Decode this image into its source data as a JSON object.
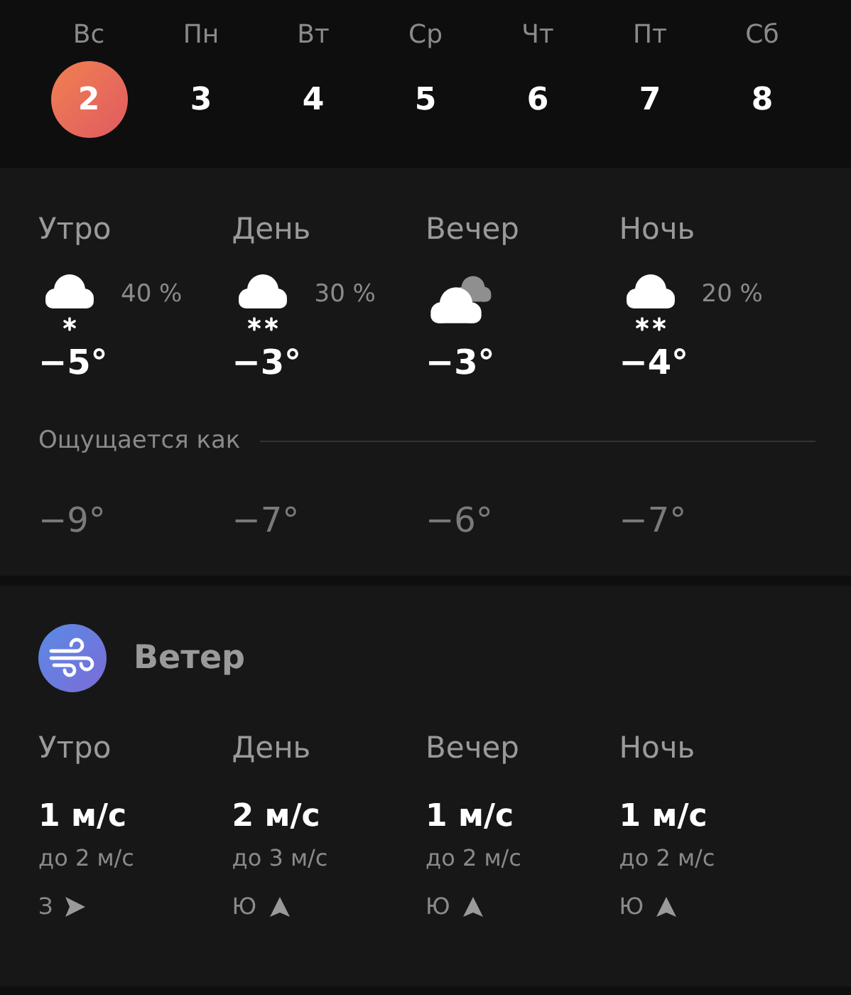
{
  "days": [
    {
      "weekday": "Вс",
      "date": "2",
      "selected": true
    },
    {
      "weekday": "Пн",
      "date": "3",
      "selected": false
    },
    {
      "weekday": "Вт",
      "date": "4",
      "selected": false
    },
    {
      "weekday": "Ср",
      "date": "5",
      "selected": false
    },
    {
      "weekday": "Чт",
      "date": "6",
      "selected": false
    },
    {
      "weekday": "Пт",
      "date": "7",
      "selected": false
    },
    {
      "weekday": "Сб",
      "date": "8",
      "selected": false
    }
  ],
  "forecast": {
    "periods": [
      {
        "label": "Утро",
        "kind": "light-snow",
        "precip": "40 %",
        "temp": "−5°"
      },
      {
        "label": "День",
        "kind": "snow",
        "precip": "30 %",
        "temp": "−3°"
      },
      {
        "label": "Вечер",
        "kind": "cloudy",
        "temp": "−3°"
      },
      {
        "label": "Ночь",
        "kind": "snow",
        "precip": "20 %",
        "temp": "−4°"
      }
    ],
    "feels_like_label": "Ощущается как",
    "feels_like": [
      "−9°",
      "−7°",
      "−6°",
      "−7°"
    ]
  },
  "wind": {
    "title": "Ветер",
    "periods": [
      {
        "label": "Утро",
        "speed": "1 м/с",
        "gusts": "до 2 м/с",
        "direction": "З",
        "kind": "rightward"
      },
      {
        "label": "День",
        "speed": "2 м/с",
        "gusts": "до 3 м/с",
        "direction": "Ю",
        "kind": "upward"
      },
      {
        "label": "Вечер",
        "speed": "1 м/с",
        "gusts": "до 2 м/с",
        "direction": "Ю",
        "kind": "upward"
      },
      {
        "label": "Ночь",
        "speed": "1 м/с",
        "gusts": "до 2 м/с",
        "direction": "Ю",
        "kind": "upward"
      }
    ]
  }
}
